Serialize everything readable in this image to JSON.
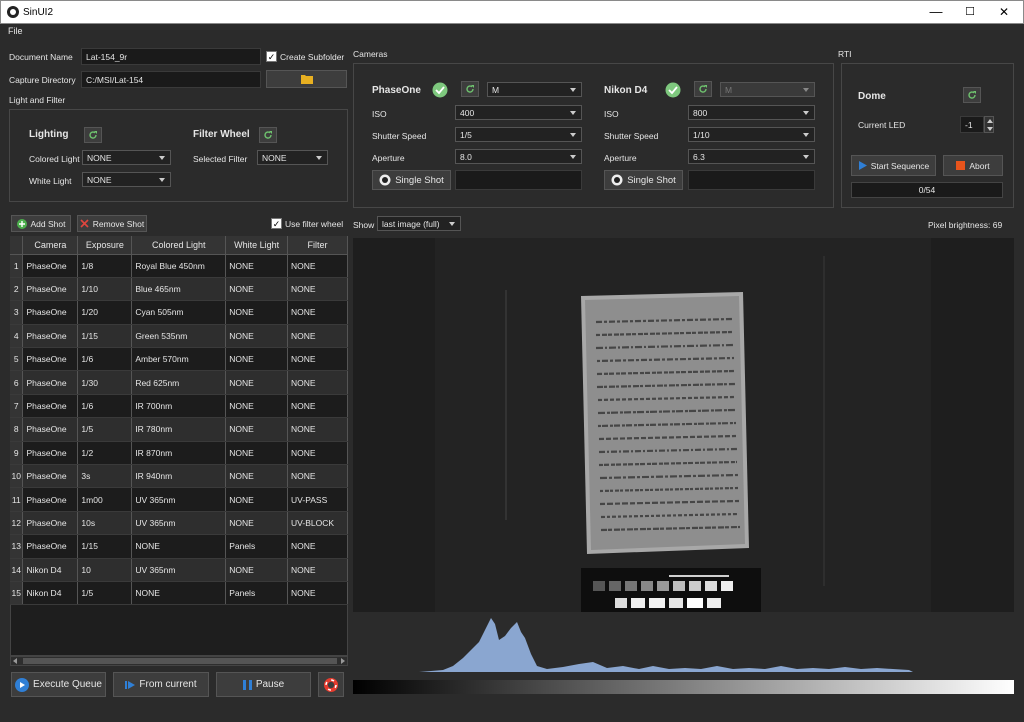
{
  "window": {
    "title": "SinUI2",
    "minimize": "—",
    "maximize": "☐",
    "close": "✕"
  },
  "menu": {
    "file": "File"
  },
  "document": {
    "name_label": "Document Name",
    "name_value": "Lat-154_9r",
    "create_subfolder_label": "Create Subfolder",
    "create_subfolder_checked": true,
    "capture_dir_label": "Capture Directory",
    "capture_dir_value": "C:/MSI/Lat-154"
  },
  "light_filter": {
    "title": "Light and Filter",
    "lighting": "Lighting",
    "filter_wheel": "Filter Wheel",
    "colored_light_label": "Colored Light",
    "colored_light_value": "NONE",
    "white_light_label": "White Light",
    "white_light_value": "NONE",
    "selected_filter_label": "Selected Filter",
    "selected_filter_value": "NONE"
  },
  "cameras": {
    "title": "Cameras",
    "cam1": {
      "name": "PhaseOne",
      "mode": "M",
      "iso_label": "ISO",
      "iso": "400",
      "shutter_label": "Shutter Speed",
      "shutter": "1/5",
      "aperture_label": "Aperture",
      "aperture": "8.0",
      "single_shot": "Single Shot"
    },
    "cam2": {
      "name": "Nikon D4",
      "mode": "M",
      "iso_label": "ISO",
      "iso": "800",
      "shutter_label": "Shutter Speed",
      "shutter": "1/10",
      "aperture_label": "Aperture",
      "aperture": "6.3",
      "single_shot": "Single Shot"
    }
  },
  "rti": {
    "title": "RTI",
    "dome": "Dome",
    "current_led_label": "Current LED",
    "current_led_value": "-1",
    "start_sequence": "Start Sequence",
    "abort": "Abort",
    "progress_text": "0/54",
    "progress": 0
  },
  "shots": {
    "add": "Add Shot",
    "remove": "Remove Shot",
    "use_filter_wheel": "Use filter wheel",
    "use_filter_wheel_checked": true,
    "columns": [
      "Camera",
      "Exposure",
      "Colored Light",
      "White Light",
      "Filter"
    ],
    "rows": [
      {
        "idx": "1",
        "camera": "PhaseOne",
        "exposure": "1/8",
        "colored": "Royal Blue 450nm",
        "white": "NONE",
        "filter": "NONE"
      },
      {
        "idx": "2",
        "camera": "PhaseOne",
        "exposure": "1/10",
        "colored": "Blue 465nm",
        "white": "NONE",
        "filter": "NONE"
      },
      {
        "idx": "3",
        "camera": "PhaseOne",
        "exposure": "1/20",
        "colored": "Cyan 505nm",
        "white": "NONE",
        "filter": "NONE"
      },
      {
        "idx": "4",
        "camera": "PhaseOne",
        "exposure": "1/15",
        "colored": "Green 535nm",
        "white": "NONE",
        "filter": "NONE"
      },
      {
        "idx": "5",
        "camera": "PhaseOne",
        "exposure": "1/6",
        "colored": "Amber 570nm",
        "white": "NONE",
        "filter": "NONE"
      },
      {
        "idx": "6",
        "camera": "PhaseOne",
        "exposure": "1/30",
        "colored": "Red 625nm",
        "white": "NONE",
        "filter": "NONE"
      },
      {
        "idx": "7",
        "camera": "PhaseOne",
        "exposure": "1/6",
        "colored": "IR 700nm",
        "white": "NONE",
        "filter": "NONE"
      },
      {
        "idx": "8",
        "camera": "PhaseOne",
        "exposure": "1/5",
        "colored": "IR 780nm",
        "white": "NONE",
        "filter": "NONE"
      },
      {
        "idx": "9",
        "camera": "PhaseOne",
        "exposure": "1/2",
        "colored": "IR 870nm",
        "white": "NONE",
        "filter": "NONE"
      },
      {
        "idx": "10",
        "camera": "PhaseOne",
        "exposure": "3s",
        "colored": "IR 940nm",
        "white": "NONE",
        "filter": "NONE"
      },
      {
        "idx": "11",
        "camera": "PhaseOne",
        "exposure": "1m00",
        "colored": "UV 365nm",
        "white": "NONE",
        "filter": "UV-PASS"
      },
      {
        "idx": "12",
        "camera": "PhaseOne",
        "exposure": "10s",
        "colored": "UV 365nm",
        "white": "NONE",
        "filter": "UV-BLOCK"
      },
      {
        "idx": "13",
        "camera": "PhaseOne",
        "exposure": "1/15",
        "colored": "NONE",
        "white": "Panels",
        "filter": "NONE"
      },
      {
        "idx": "14",
        "camera": "Nikon D4",
        "exposure": "10",
        "colored": "UV 365nm",
        "white": "NONE",
        "filter": "NONE"
      },
      {
        "idx": "15",
        "camera": "Nikon D4",
        "exposure": "1/5",
        "colored": "NONE",
        "white": "Panels",
        "filter": "NONE"
      }
    ]
  },
  "view": {
    "show_label": "Show",
    "show_value": "last image (full)",
    "pixel_brightness": "Pixel brightness: 69"
  },
  "queue": {
    "execute": "Execute Queue",
    "from_current": "From current",
    "pause": "Pause"
  },
  "colors": {
    "accent_blue": "#2f7fd6",
    "check_green": "#7ec87e",
    "abort_orange": "#e8541c",
    "histogram": "#8aa6d0"
  }
}
